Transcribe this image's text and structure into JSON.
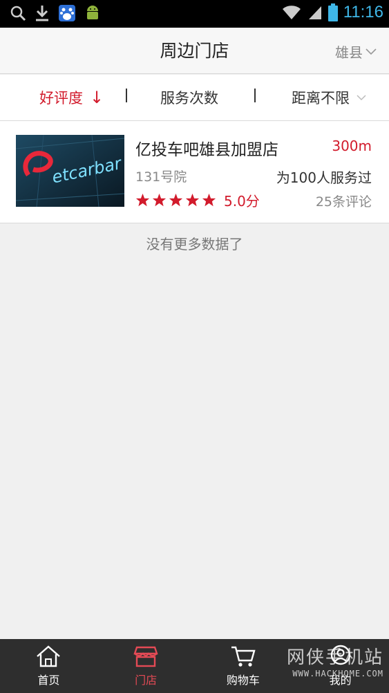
{
  "status_bar": {
    "time": "11:16"
  },
  "header": {
    "title": "周边门店",
    "city": "雄县"
  },
  "filters": {
    "sort_rating": "好评度",
    "sort_rating_arrow": "↓",
    "service_count": "服务次数",
    "distance": "距离不限"
  },
  "stores": [
    {
      "name": "亿投车吧雄县加盟店",
      "distance": "300m",
      "address": "131号院",
      "served": "为100人服务过",
      "rating": 5.0,
      "rating_label": "5.0分",
      "reviews": "25条评论",
      "logo_text": "etcarbar"
    }
  ],
  "empty_message": "没有更多数据了",
  "bottom_nav": [
    {
      "label": "首页",
      "icon": "home-icon"
    },
    {
      "label": "门店",
      "icon": "store-icon",
      "active": true
    },
    {
      "label": "购物车",
      "icon": "cart-icon"
    },
    {
      "label": "我的",
      "icon": "profile-icon"
    }
  ],
  "watermark": {
    "text": "网侠手机站",
    "url": "WWW.HACKHOME.COM"
  },
  "colors": {
    "accent": "#d21b2c",
    "nav_bg": "#2e2e2e",
    "time": "#3fb7e8"
  }
}
